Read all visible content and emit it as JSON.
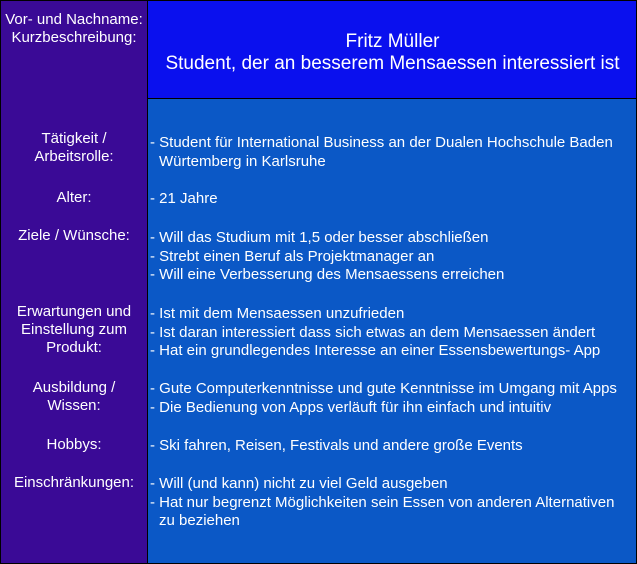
{
  "header": {
    "label_name": "Vor- und Nachname:",
    "label_desc": "Kurzbeschreibung:",
    "name": "Fritz Müller",
    "description": "Student, der an besserem Mensaessen interessiert ist"
  },
  "rows": {
    "taetigkeit": {
      "label": [
        "Tätigkeit /",
        "Arbeitsrolle:"
      ],
      "lines": [
        "- Student für International Business an der Dualen Hochschule Baden",
        "Würtemberg in Karlsruhe"
      ]
    },
    "alter": {
      "label": [
        "Alter:"
      ],
      "lines": [
        "- 21 Jahre"
      ]
    },
    "ziele": {
      "label": [
        "Ziele / Wünsche:"
      ],
      "lines": [
        "- Will das Studium mit 1,5 oder besser abschließen",
        "- Strebt einen Beruf als Projektmanager an",
        "- Will eine Verbesserung des Mensaessens erreichen"
      ]
    },
    "erwartungen": {
      "label": [
        "Erwartungen und",
        "Einstellung zum",
        "Produkt:"
      ],
      "lines": [
        "- Ist mit dem Mensaessen unzufrieden",
        "- Ist daran interessiert dass sich etwas an dem Mensaessen ändert",
        "- Hat ein grundlegendes Interesse an einer Essensbewertungs- App"
      ]
    },
    "ausbildung": {
      "label": [
        "Ausbildung /",
        "Wissen:"
      ],
      "lines": [
        "- Gute Computerkenntnisse und gute Kenntnisse im Umgang mit Apps",
        "- Die Bedienung von Apps verläuft für ihn einfach und intuitiv"
      ]
    },
    "hobbys": {
      "label": [
        "Hobbys:"
      ],
      "lines": [
        "- Ski fahren, Reisen, Festivals und andere große Events"
      ]
    },
    "einschraenkungen": {
      "label": [
        "Einschränkungen:"
      ],
      "lines": [
        "- Will (und kann) nicht zu viel Geld ausgeben",
        "- Hat nur begrenzt Möglichkeiten sein Essen von anderen Alternativen",
        "zu beziehen"
      ]
    }
  },
  "colors": {
    "left_column": "#3a0a96",
    "header_box": "#0a10ee",
    "body_box": "#0b58c6",
    "text": "#ffffff"
  }
}
